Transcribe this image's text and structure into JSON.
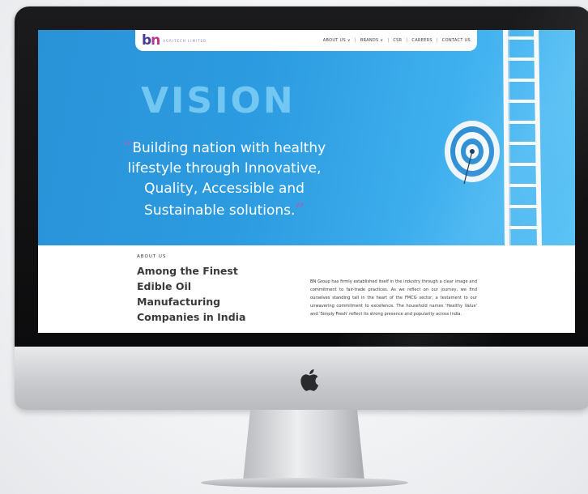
{
  "navbar": {
    "logo_text": "bn",
    "logo_subtext": "AGRITECH LIMITED",
    "items": [
      {
        "label": "ABOUT US ∨"
      },
      {
        "label": "BRANDS ∨"
      },
      {
        "label": "CSR"
      },
      {
        "label": "CAREERS"
      },
      {
        "label": "CONTACT US"
      }
    ],
    "separator": "|"
  },
  "hero": {
    "heading": "VISION",
    "quote_open": "“",
    "quote_text": "Building nation with healthy lifestyle through Innovative, Quality, Accessible and Sustainable solutions.",
    "quote_close": "”",
    "background_color": "#2c9be0",
    "heading_color": "#7fd0f6",
    "quote_mark_color": "#8a6fc9"
  },
  "about": {
    "tag": "ABOUT US",
    "title": "Among the Finest Edible Oil Manufacturing Companies in India",
    "body": "BN Group has firmly established itself in the industry through a clear image and commitment to fair-trade practices. As we reflect on our journey, we find ourselves standing tall in the heart of the FMCG sector, a testament to our unwavering commitment to excellence. The household names 'Healthy Value' and 'Simply Fresh' reflect its strong presence and popularity across India."
  },
  "device": {
    "icons": [
      "apple-logo-icon",
      "target-icon",
      "ladder-icon"
    ]
  }
}
